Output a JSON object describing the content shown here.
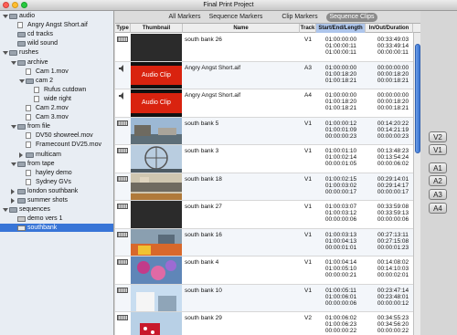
{
  "window": {
    "title": "Final Print Project"
  },
  "sidebar": {
    "items": [
      {
        "label": "audio",
        "kind": "folder",
        "indent": 0,
        "state": "open"
      },
      {
        "label": "Angry Angst Short.aif",
        "kind": "file",
        "indent": 1,
        "state": "none"
      },
      {
        "label": "cd tracks",
        "kind": "folder",
        "indent": 1,
        "state": "none"
      },
      {
        "label": "wild sound",
        "kind": "folder",
        "indent": 1,
        "state": "none"
      },
      {
        "label": "rushes",
        "kind": "folder",
        "indent": 0,
        "state": "open"
      },
      {
        "label": "archive",
        "kind": "folder",
        "indent": 1,
        "state": "open"
      },
      {
        "label": "Cam 1.mov",
        "kind": "file",
        "indent": 2,
        "state": "none"
      },
      {
        "label": "cam 2",
        "kind": "folder",
        "indent": 2,
        "state": "open"
      },
      {
        "label": "Rufus cutdown",
        "kind": "file",
        "indent": 3,
        "state": "none"
      },
      {
        "label": "wide right",
        "kind": "file",
        "indent": 3,
        "state": "none"
      },
      {
        "label": "Cam 2.mov",
        "kind": "file",
        "indent": 2,
        "state": "none"
      },
      {
        "label": "Cam 3.mov",
        "kind": "file",
        "indent": 2,
        "state": "none"
      },
      {
        "label": "from file",
        "kind": "folder",
        "indent": 1,
        "state": "open"
      },
      {
        "label": "DV50 showreel.mov",
        "kind": "file",
        "indent": 2,
        "state": "none"
      },
      {
        "label": "Framecount DV25.mov",
        "kind": "file",
        "indent": 2,
        "state": "none"
      },
      {
        "label": "multicam",
        "kind": "folder",
        "indent": 2,
        "state": "closed"
      },
      {
        "label": "from tape",
        "kind": "folder",
        "indent": 1,
        "state": "open"
      },
      {
        "label": "hayley demo",
        "kind": "file",
        "indent": 2,
        "state": "none"
      },
      {
        "label": "Sydney GVs",
        "kind": "file",
        "indent": 2,
        "state": "none"
      },
      {
        "label": "london southbank",
        "kind": "folder",
        "indent": 1,
        "state": "closed"
      },
      {
        "label": "summer shots",
        "kind": "folder",
        "indent": 1,
        "state": "closed"
      },
      {
        "label": "sequences",
        "kind": "folder",
        "indent": 0,
        "state": "open"
      },
      {
        "label": "demo vers 1",
        "kind": "seq",
        "indent": 1,
        "state": "none"
      },
      {
        "label": "southbank",
        "kind": "seq",
        "indent": 1,
        "state": "none",
        "selected": true
      }
    ]
  },
  "tabs": [
    {
      "label": "All Markers",
      "active": false
    },
    {
      "label": "Sequence Markers",
      "active": false
    },
    {
      "label": "Clip Markers",
      "active": false
    },
    {
      "label": "Sequence Clips",
      "active": true
    }
  ],
  "columns": {
    "type": "Type",
    "thumbnail": "Thumbnail",
    "name": "Name",
    "track": "Track",
    "start_end_length": "Start/End/Length",
    "in_out_duration": "In/Out/Duration"
  },
  "rows": [
    {
      "type": "video",
      "thumb": "blackframe",
      "name": "south bank 26",
      "track": "V1",
      "start": "01:00:00:00",
      "end": "01:00:00:11",
      "length": "01:00:00:11",
      "in": "00:33:49:03",
      "out": "00:33:49:14",
      "duration": "00:00:00:11"
    },
    {
      "type": "audio",
      "thumb": "audioclip",
      "thumb_label": "Audio Clip",
      "name": "Angry Angst Short.aif",
      "track": "A3",
      "start": "01:00:00:00",
      "end": "01:00:18:20",
      "length": "01:00:18:21",
      "in": "00:00:00:00",
      "out": "00:00:18:20",
      "duration": "00:00:18:21"
    },
    {
      "type": "audio",
      "thumb": "audioclip",
      "thumb_label": "Audio Clip",
      "name": "Angry Angst Short.aif",
      "track": "A4",
      "start": "01:00:00:00",
      "end": "01:00:18:20",
      "length": "01:00:18:21",
      "in": "00:00:00:00",
      "out": "00:00:18:20",
      "duration": "00:00:18:21"
    },
    {
      "type": "video",
      "thumb": "river",
      "name": "south bank 5",
      "track": "V1",
      "start": "01:00:00:12",
      "end": "01:00:01:09",
      "length": "00:00:00:23",
      "in": "00:14:20:22",
      "out": "00:14:21:19",
      "duration": "00:00:00:23"
    },
    {
      "type": "video",
      "thumb": "ferris",
      "name": "south bank 3",
      "track": "V1",
      "start": "01:00:01:10",
      "end": "01:00:02:14",
      "length": "00:00:01:05",
      "in": "00:13:48:23",
      "out": "00:13:54:24",
      "duration": "00:00:06:02"
    },
    {
      "type": "video",
      "thumb": "building",
      "name": "south bank 18",
      "track": "V1",
      "start": "01:00:02:15",
      "end": "01:00:03:02",
      "length": "00:00:00:17",
      "in": "00:29:14:01",
      "out": "00:29:14:17",
      "duration": "00:00:00:17"
    },
    {
      "type": "video",
      "thumb": "blackframe",
      "name": "south bank 27",
      "track": "V1",
      "start": "01:00:03:07",
      "end": "01:00:03:12",
      "length": "00:00:00:06",
      "in": "00:33:59:08",
      "out": "00:33:59:13",
      "duration": "00:00:00:06"
    },
    {
      "type": "video",
      "thumb": "colorful",
      "name": "south bank 16",
      "track": "V1",
      "start": "01:00:03:13",
      "end": "01:00:04:13",
      "length": "00:00:01:01",
      "in": "00:27:13:11",
      "out": "00:27:15:08",
      "duration": "00:00:01:23"
    },
    {
      "type": "video",
      "thumb": "balloons",
      "name": "south bank 4",
      "track": "V1",
      "start": "01:00:04:14",
      "end": "01:00:05:10",
      "length": "00:00:00:21",
      "in": "00:14:08:02",
      "out": "00:14:10:03",
      "duration": "00:00:02:01"
    },
    {
      "type": "video",
      "thumb": "building2",
      "name": "south bank 10",
      "track": "V1",
      "start": "01:00:05:11",
      "end": "01:00:06:01",
      "length": "00:00:00:06",
      "in": "00:23:47:14",
      "out": "00:23:48:01",
      "duration": "00:00:00:12"
    },
    {
      "type": "video",
      "thumb": "polka",
      "name": "south bank 29",
      "track": "V2",
      "start": "01:00:06:02",
      "end": "01:00:06:23",
      "length": "00:00:00:22",
      "in": "00:34:55:23",
      "out": "00:34:56:20",
      "duration": "00:00:00:22"
    }
  ],
  "track_buttons": [
    "V2",
    "V1",
    "A1",
    "A2",
    "A3",
    "A4"
  ],
  "colors": {
    "selection": "#3875d7",
    "tab_active": "#8b8b8b",
    "audio_clip": "#d9230f"
  }
}
